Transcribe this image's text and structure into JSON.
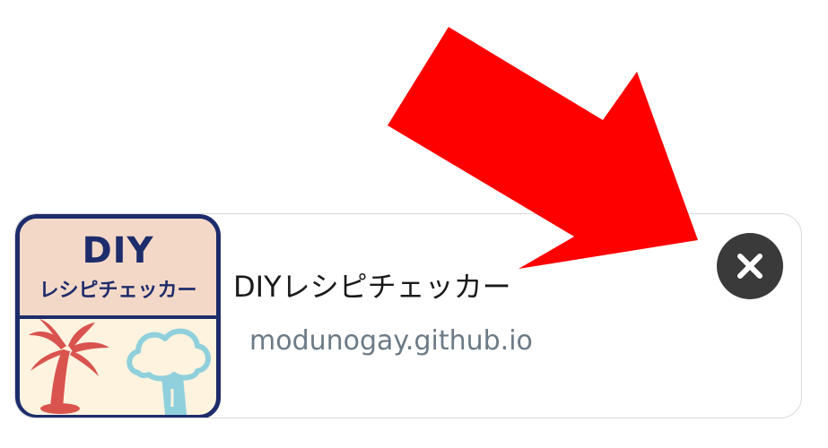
{
  "banner": {
    "app_icon": {
      "title": "DIY",
      "subtitle": "レシピチェッカー"
    },
    "app_name": "DIYレシピチェッカー",
    "url": "modunogay.github.io",
    "close_icon": "close-icon"
  },
  "annotation": {
    "arrow_icon": "red-arrow-icon",
    "color": "#ff0000"
  },
  "colors": {
    "icon_border": "#1d2c6b",
    "icon_top": "#f4d8c7",
    "icon_bottom": "#fdf3df",
    "palm": "#d9534f",
    "tree": "#8fd0dc",
    "url_text": "#6c7a86",
    "close_button": "#3a3a3a"
  }
}
